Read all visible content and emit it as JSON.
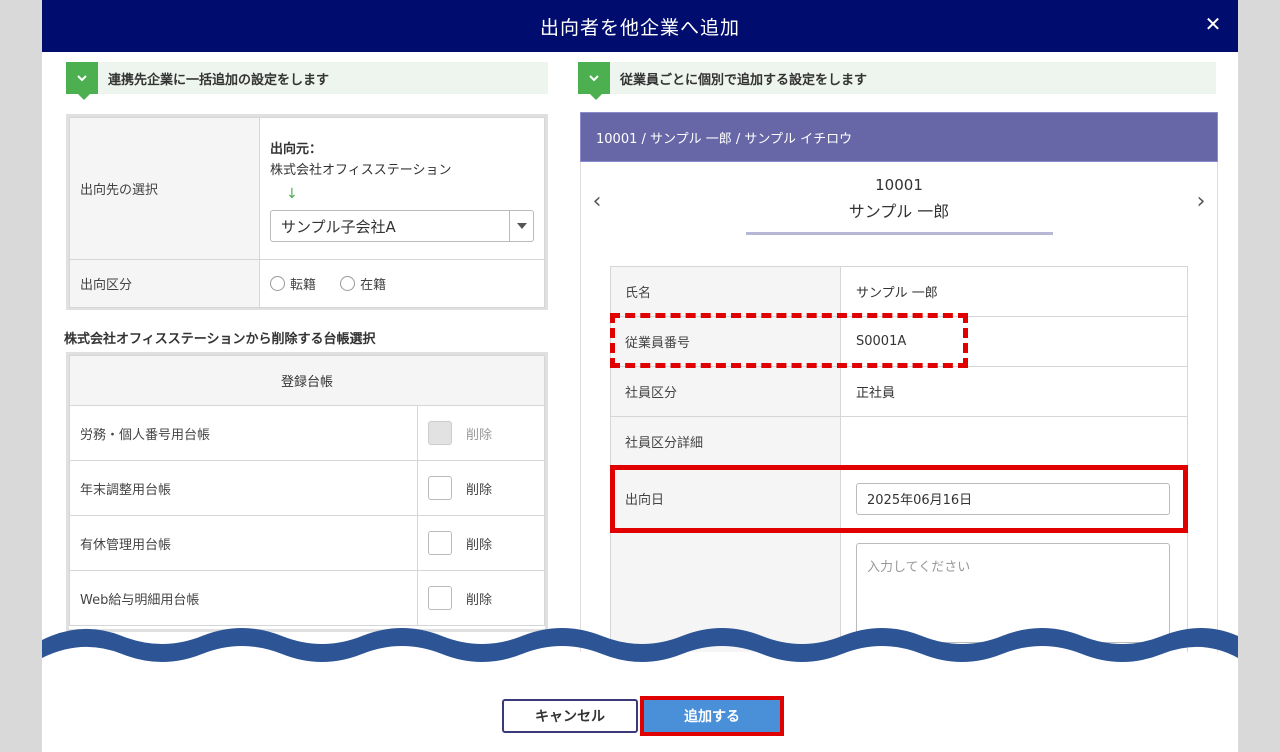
{
  "modal": {
    "title": "出向者を他企業へ追加",
    "close_icon": "close-icon"
  },
  "left": {
    "section_title": "連携先企業に一括追加の設定をします",
    "destination": {
      "label": "出向先の選択",
      "source_label": "出向元：",
      "source_company": "株式会社オフィスステーション",
      "arrow_icon": "arrow-down-icon",
      "selected_company": "サンプル子会社A"
    },
    "transfer_type": {
      "label": "出向区分",
      "options": [
        "転籍",
        "在籍"
      ]
    },
    "ledger_section_title": "株式会社オフィスステーションから削除する台帳選択",
    "ledger_header": "登録台帳",
    "ledgers": [
      {
        "name": "労務・個人番号用台帳",
        "action": "削除",
        "disabled": true
      },
      {
        "name": "年末調整用台帳",
        "action": "削除",
        "disabled": false
      },
      {
        "name": "有休管理用台帳",
        "action": "削除",
        "disabled": false
      },
      {
        "name": "Web給与明細用台帳",
        "action": "削除",
        "disabled": false
      }
    ]
  },
  "right": {
    "section_title": "従業員ごとに個別で追加する設定をします",
    "employee_bar": "10001 / サンプル 一郎 / サンプル イチロウ",
    "employee_number": "10001",
    "employee_name": "サンプル 一郎",
    "fields": {
      "name_label": "氏名",
      "name_value": "サンプル 一郎",
      "emp_no_label": "従業員番号",
      "emp_no_value": "S0001A",
      "emp_type_label": "社員区分",
      "emp_type_value": "正社員",
      "emp_type_detail_label": "社員区分詳細",
      "emp_type_detail_value": "",
      "transfer_date_label": "出向日",
      "transfer_date_value": "2025年06月16日",
      "note_placeholder": "入力してください"
    }
  },
  "footer": {
    "cancel_label": "キャンセル",
    "add_label": "追加する"
  },
  "colors": {
    "header": "#000c6e",
    "accent_green": "#4caf50",
    "employee_bar": "#6767a8",
    "highlight": "#e00000",
    "primary_button": "#4a90d9",
    "wave": "#2d5596"
  }
}
